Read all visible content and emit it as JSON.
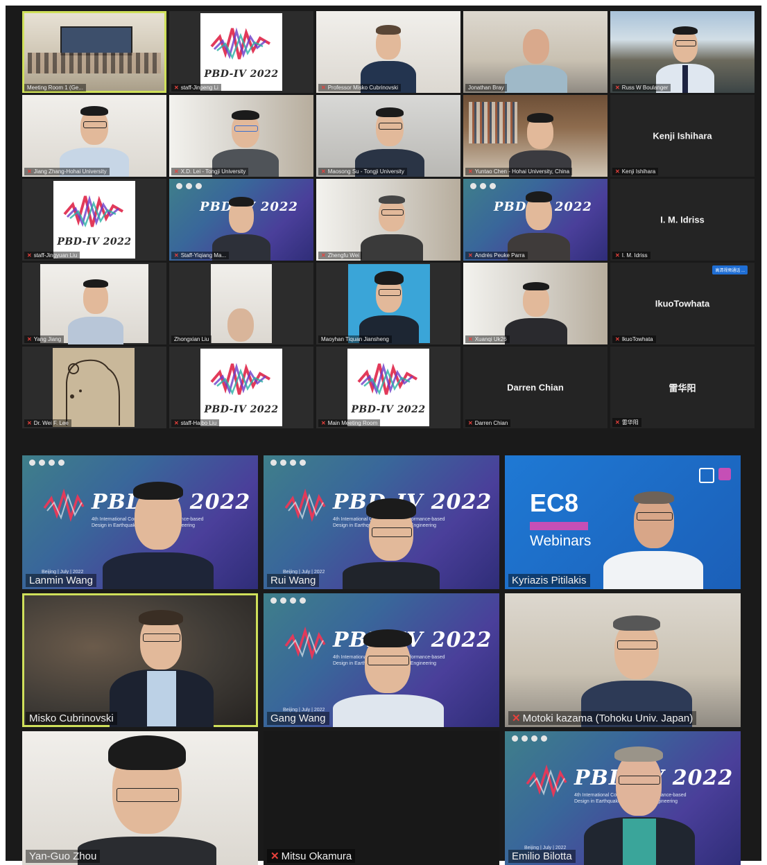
{
  "logo_text": "PBD-IV 2022",
  "banner": {
    "title": "PBD-IV 2022",
    "subtitle_line1": "4th International Conference on Performance-based",
    "subtitle_line2": "Design in Earthquake Geotechnical Engineering",
    "location": "Beijing | July | 2022"
  },
  "ec8": {
    "title": "EC8",
    "subtitle": "Webinars"
  },
  "small_tiles": [
    {
      "label": "Meeting Room 1 (Ge..."
    },
    {
      "label": "staff-Jinpeng Li"
    },
    {
      "label": "Professor Misko Cubrinovski"
    },
    {
      "label": "Jonathan Bray"
    },
    {
      "label": "Russ W Boulanger"
    },
    {
      "label": "Jiang Zhang-Hohai University"
    },
    {
      "label": "X.D. Lei - Tongji University"
    },
    {
      "label": "Maosong Su - Tongji University"
    },
    {
      "label": "Yuntao Chen - Hohai University, China"
    },
    {
      "label": "Kenji Ishihara",
      "center": "Kenji Ishihara"
    },
    {
      "label": "staff-Jingyuan Liu"
    },
    {
      "label": "Staff-Yiqiang Ma..."
    },
    {
      "label": "Zhengfu Wei"
    },
    {
      "label": "Andrés Peuke Parra"
    },
    {
      "label": "I. M. Idriss",
      "center": "I. M. Idriss"
    },
    {
      "label": "Yang Jiang"
    },
    {
      "label": "Zhongxian Liu"
    },
    {
      "label": "Maoyhan Tiquan Jiansheng"
    },
    {
      "label": "Xuanqi Uk26"
    },
    {
      "label": "IkuoTowhata",
      "center": "IkuoTowhata"
    },
    {
      "label": "Dr. Wei F. Lee"
    },
    {
      "label": "staff-Haibo Liu"
    },
    {
      "label": "Main Meeting Room"
    },
    {
      "label": "Darren Chian",
      "center": "Darren Chian"
    },
    {
      "label": "雷华阳",
      "center": "雷华阳"
    }
  ],
  "badge_text": "高清视频通话 ...",
  "large_tiles": [
    {
      "label": "Lanmin Wang"
    },
    {
      "label": "Rui Wang"
    },
    {
      "label": "Kyriazis Pitilakis"
    },
    {
      "label": "Misko Cubrinovski"
    },
    {
      "label": "Gang Wang"
    },
    {
      "label": "Motoki kazama (Tohoku Univ. Japan)"
    },
    {
      "label": "Yan-Guo Zhou"
    },
    {
      "label": "Mitsu Okamura"
    },
    {
      "label": "Emilio Bilotta"
    }
  ],
  "colors": {
    "active_speaker_border": "#cfe05a",
    "muted_icon": "#e8413c",
    "background": "#1a1a1a"
  }
}
